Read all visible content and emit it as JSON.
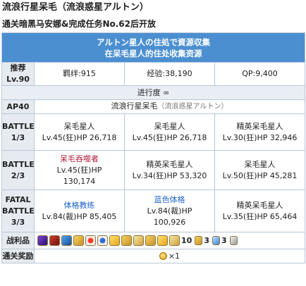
{
  "page": {
    "title": "流浪行星呆毛（流浪惑星アルトン）",
    "condition": "通关暗黑马安娜&完成任务No.62后开放"
  },
  "quest": {
    "header_line1": "アルトン星人の住処で資源収集",
    "header_line2": "在呆毛星人的住处收集资源",
    "recommend_label_1": "推荐",
    "recommend_label_2": "Lv.90",
    "bond": "羁绊:915",
    "exp": "经验:38,190",
    "qp": "QP:9,400",
    "progress": "进行度 ∞",
    "ap": "AP40",
    "location": "流浪行星呆毛",
    "location_jp": "（流浪惑星アルトン）"
  },
  "battles": [
    {
      "label_lines": [
        "BATTLE",
        "1/3"
      ],
      "enemies": [
        {
          "name": "呆毛星人",
          "stats": "Lv.45(狂)HP 26,718",
          "color": "normal"
        },
        {
          "name": "呆毛星人",
          "stats": "Lv.45(狂)HP 26,718",
          "color": "normal"
        },
        {
          "name": "精英呆毛星人",
          "stats": "Lv.30(狂)HP 32,946",
          "color": "normal"
        }
      ]
    },
    {
      "label_lines": [
        "BATTLE",
        "2/3"
      ],
      "enemies": [
        {
          "name": "呆毛吞噬者",
          "stats": "Lv.45(狂)HP",
          "stats2": "130,174",
          "color": "red"
        },
        {
          "name": "精英呆毛星人",
          "stats": "Lv.34(狂)HP 53,320",
          "color": "normal"
        },
        {
          "name": "呆毛星人",
          "stats": "Lv.50(狂)HP 45,281",
          "color": "normal"
        }
      ]
    },
    {
      "label_lines": [
        "FATAL",
        "BATTLE",
        "3/3"
      ],
      "enemies": [
        {
          "name": "体格教练",
          "stats": "Lv.84(裁)HP 85,405",
          "color": "blue"
        },
        {
          "name": "蓝色体格",
          "stats": "Lv.84(裁)HP",
          "stats2": "100,926",
          "color": "blue"
        },
        {
          "name": "精英呆毛星人",
          "stats": "Lv.35(狂)HP 65,464",
          "color": "normal"
        }
      ]
    }
  ],
  "drops": {
    "label": "战利品",
    "icons": [
      "purple-gem-icon",
      "red-gem-icon",
      "blue-gem-icon",
      "gold-piece-icon",
      "red-orb-icon",
      "blue-orb-icon",
      "yellow-item-icon",
      "gold-item-icon",
      "bell-icon",
      "gold-pouch-icon",
      "yellow-material-icon",
      "gold-chunk-icon"
    ],
    "counts": [
      {
        "value": "10",
        "icon": "gold-coin-icon"
      },
      {
        "value": "3",
        "icon": "blue-ticket-icon"
      },
      {
        "value": "3",
        "icon": "silver-ticket-icon"
      }
    ]
  },
  "reward": {
    "label": "通关奖励",
    "value": "×1"
  }
}
